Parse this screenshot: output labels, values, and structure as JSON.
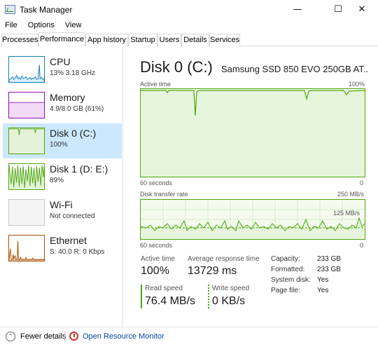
{
  "window": {
    "title": "Task Manager",
    "minimize_glyph": "—",
    "maximize_glyph": "☐",
    "close_glyph": "✕"
  },
  "menu": [
    "File",
    "Options",
    "View"
  ],
  "tabs": [
    "Processes",
    "Performance",
    "App history",
    "Startup",
    "Users",
    "Details",
    "Services"
  ],
  "active_tab": "Performance",
  "resources": [
    {
      "name": "CPU",
      "detail": "13%  3.18 GHz",
      "color": "#117dbb",
      "usage": 0.13
    },
    {
      "name": "Memory",
      "detail": "4.9/8.0 GB (61%)",
      "color": "#8b12ae",
      "usage": 0.61
    },
    {
      "name": "Disk 0 (C:)",
      "detail": "100%",
      "color": "#4da60c",
      "usage": 1.0
    },
    {
      "name": "Disk 1 (D: E:)",
      "detail": "89%",
      "color": "#4da60c",
      "usage": 0.89
    },
    {
      "name": "Wi-Fi",
      "detail": "Not connected",
      "color": "#a0a0a0",
      "usage": 0
    },
    {
      "name": "Ethernet",
      "detail": "S: 40.0  R: 0 Kbps",
      "color": "#a74f01",
      "usage": 0.1
    }
  ],
  "main": {
    "title": "Disk 0 (C:)",
    "device": "Samsung SSD 850 EVO 250GB AT...",
    "active_graph": {
      "label": "Active time",
      "max": "100%",
      "span": "60 seconds",
      "min": "0"
    },
    "transfer_graph": {
      "label": "Disk transfer rate",
      "max": "250 MB/s",
      "mid": "125 MB/s",
      "span": "60 seconds",
      "min": "0"
    }
  },
  "stats": {
    "active_time": {
      "label": "Active time",
      "value": "100%"
    },
    "response": {
      "label": "Average response time",
      "value": "13729 ms"
    },
    "read": {
      "label": "Read speed",
      "value": "76.4 MB/s"
    },
    "write": {
      "label": "Write speed",
      "value": "0 KB/s"
    }
  },
  "properties": [
    {
      "key": "Capacity:",
      "value": "233 GB"
    },
    {
      "key": "Formatted:",
      "value": "233 GB"
    },
    {
      "key": "System disk:",
      "value": "Yes"
    },
    {
      "key": "Page file:",
      "value": "Yes"
    }
  ],
  "footer": {
    "fewer_details": "Fewer details",
    "open_monitor": "Open Resource Monitor",
    "chevron": "⌃"
  }
}
